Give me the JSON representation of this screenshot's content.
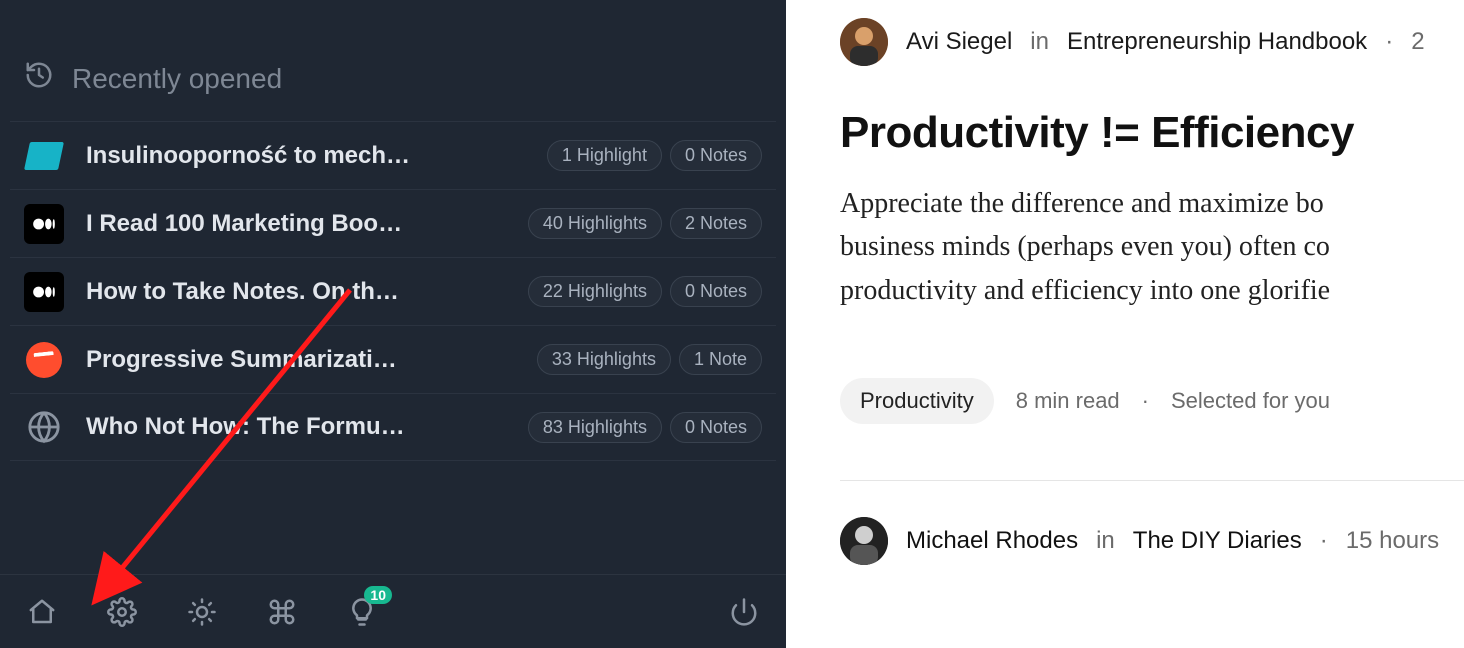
{
  "sidebar": {
    "section_title": "Recently opened",
    "items": [
      {
        "source_icon": "teal-doc",
        "title": "Insulinooporność to mech…",
        "highlights": "1 Highlight",
        "notes": "0 Notes"
      },
      {
        "source_icon": "medium",
        "title": "I Read 100 Marketing Boo…",
        "highlights": "40 Highlights",
        "notes": "2 Notes"
      },
      {
        "source_icon": "medium",
        "title": "How to Take Notes. On th…",
        "highlights": "22 Highlights",
        "notes": "0 Notes"
      },
      {
        "source_icon": "orange",
        "title": "Progressive Summarizati…",
        "highlights": "33 Highlights",
        "notes": "1 Note"
      },
      {
        "source_icon": "globe",
        "title": "Who Not How: The Formu…",
        "highlights": "83 Highlights",
        "notes": "0 Notes"
      }
    ]
  },
  "toolbar": {
    "home": "home-icon",
    "settings": "gear-icon",
    "theme": "sun-icon",
    "command": "command-icon",
    "ideas": "lightbulb-icon",
    "ideas_badge": "10",
    "power": "power-icon"
  },
  "annotation": {
    "type": "arrow",
    "color": "#ff1a1a",
    "points_to": "gear-icon"
  },
  "article": {
    "author": "Avi Siegel",
    "connector": "in",
    "publication": "Entrepreneurship Handbook",
    "time_dot": "·",
    "time_partial": "2",
    "title": "Productivity != Efficiency",
    "body_visible": "Appreciate the difference and maximize bo\nbusiness minds (perhaps even you) often co\nproductivity and efficiency into one glorifie",
    "tag": "Productivity",
    "read_time": "8 min read",
    "selected": "Selected for you"
  },
  "next_article": {
    "author": "Michael Rhodes",
    "connector": "in",
    "publication": "The DIY Diaries",
    "time_dot": "·",
    "time": "15 hours"
  }
}
